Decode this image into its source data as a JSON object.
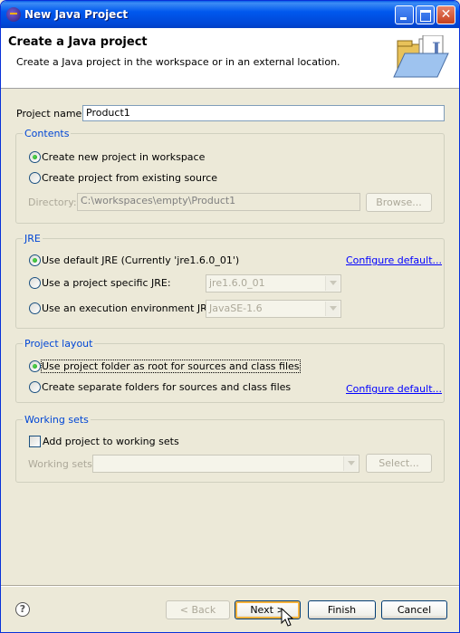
{
  "window": {
    "title": "New Java Project"
  },
  "header": {
    "title": "Create a Java project",
    "description": "Create a Java project in the workspace or in an external location."
  },
  "project_name": {
    "label": "Project name:",
    "value": "Product1"
  },
  "contents": {
    "legend": "Contents",
    "options": [
      "Create new project in workspace",
      "Create project from existing source"
    ],
    "selected": 0,
    "directory_label": "Directory:",
    "directory_value": "C:\\workspaces\\empty\\Product1",
    "browse_label": "Browse..."
  },
  "jre": {
    "legend": "JRE",
    "options": [
      "Use default JRE (Currently 'jre1.6.0_01')",
      "Use a project specific JRE:",
      "Use an execution environment JRE:"
    ],
    "selected": 0,
    "configure_link": "Configure default...",
    "specific_jre_value": "jre1.6.0_01",
    "environment_value": "JavaSE-1.6"
  },
  "layout": {
    "legend": "Project layout",
    "options": [
      "Use project folder as root for sources and class files",
      "Create separate folders for sources and class files"
    ],
    "selected": 0,
    "configure_link": "Configure default..."
  },
  "working_sets": {
    "legend": "Working sets",
    "add_label": "Add project to working sets",
    "add_checked": false,
    "sets_label": "Working sets:",
    "sets_value": "",
    "select_label": "Select..."
  },
  "footer": {
    "help_icon": "?",
    "back_label": "< Back",
    "next_label": "Next >",
    "finish_label": "Finish",
    "cancel_label": "Cancel"
  },
  "icons": {
    "title": "eclipse-icon",
    "banner": "java-project-folder-icon",
    "help": "help-icon",
    "cursor": "mouse-pointer-icon"
  },
  "colors": {
    "titlebar": "#0058ee",
    "group_legend": "#0046d5",
    "link": "#0000ff",
    "dialog_bg": "#ece9d8"
  }
}
